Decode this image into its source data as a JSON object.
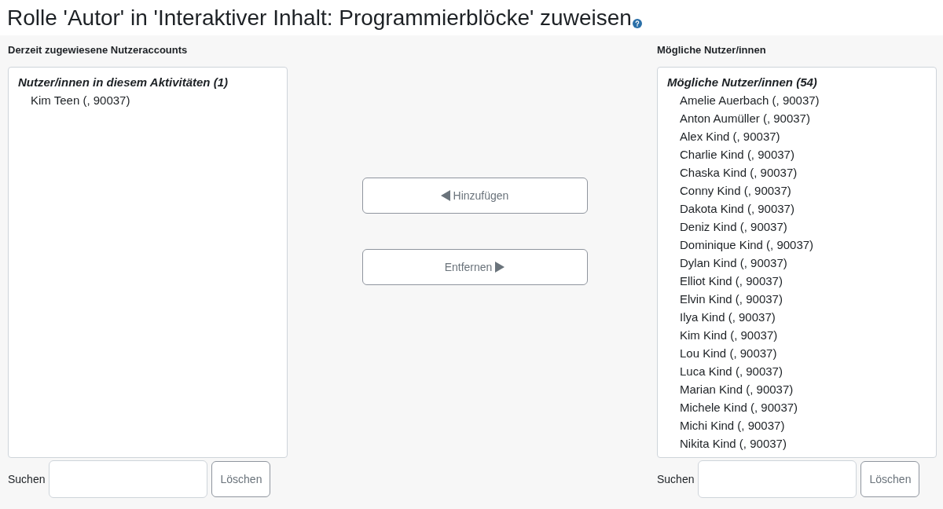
{
  "title": "Rolle 'Autor' in 'Interaktiver Inhalt: Programmierblöcke' zuweisen",
  "current": {
    "heading": "Derzeit zugewiesene Nutzeraccounts",
    "group": "Nutzer/innen in diesem Aktivitäten (1)",
    "users": [
      "Kim Teen (, 90037)"
    ],
    "search_label": "Suchen",
    "clear_button": "Löschen"
  },
  "actions": [
    {
      "kind": "add",
      "label": "Hinzufügen",
      "disabled": true
    },
    {
      "kind": "remove",
      "label": "Entfernen",
      "disabled": true
    }
  ],
  "potential": {
    "heading": "Mögliche Nutzer/innen",
    "group": "Mögliche Nutzer/innen (54)",
    "users": [
      "Amelie Auerbach (, 90037)",
      "Anton Aumüller (, 90037)",
      "Alex Kind (, 90037)",
      "Charlie Kind (, 90037)",
      "Chaska Kind (, 90037)",
      "Conny Kind (, 90037)",
      "Dakota Kind (, 90037)",
      "Deniz Kind (, 90037)",
      "Dominique Kind (, 90037)",
      "Dylan Kind (, 90037)",
      "Elliot Kind (, 90037)",
      "Elvin Kind (, 90037)",
      "Ilya Kind (, 90037)",
      "Kim Kind (, 90037)",
      "Lou Kind (, 90037)",
      "Luca Kind (, 90037)",
      "Marian Kind (, 90037)",
      "Michele Kind (, 90037)",
      "Michi Kind (, 90037)",
      "Nikita Kind (, 90037)"
    ],
    "search_label": "Suchen",
    "clear_button": "Löschen"
  }
}
